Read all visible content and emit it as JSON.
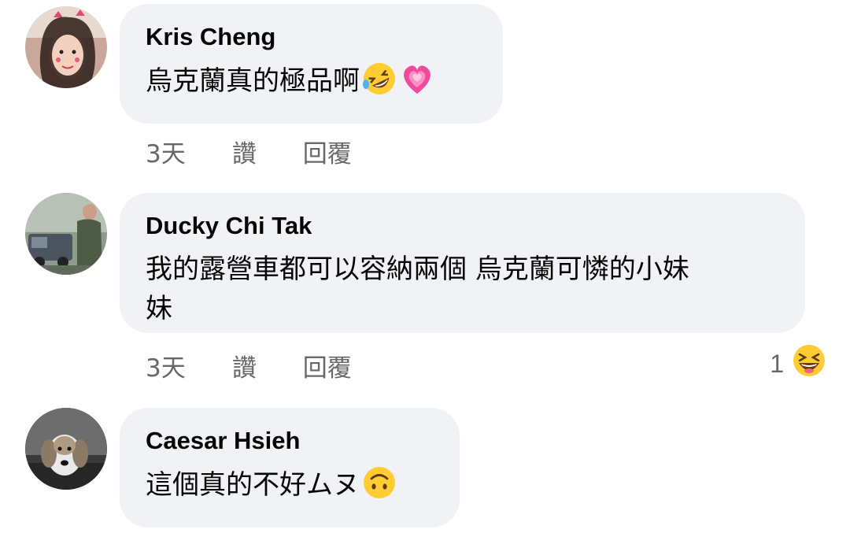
{
  "comments": [
    {
      "author": "Kris Cheng",
      "text": "烏克蘭真的極品啊",
      "emoji": [
        "rolling-on-floor-laughing-icon",
        "growing-heart-icon"
      ],
      "time": "3天",
      "like": "讚",
      "reply": "回覆"
    },
    {
      "author": "Ducky Chi Tak",
      "text_line1": "我的露營車都可以容納兩個 烏克蘭可憐的小妹",
      "text_line2": "妹",
      "time": "3天",
      "like": "讚",
      "reply": "回覆",
      "reaction_count": "1",
      "reaction_icon": "grinning-squinting-face-icon"
    },
    {
      "author": "Caesar Hsieh",
      "text": "這個真的不好ムヌ",
      "emoji": [
        "upside-down-face-icon"
      ]
    }
  ],
  "colors": {
    "bubble": "#f0f2f5",
    "meta": "#65676b",
    "text": "#050505"
  }
}
